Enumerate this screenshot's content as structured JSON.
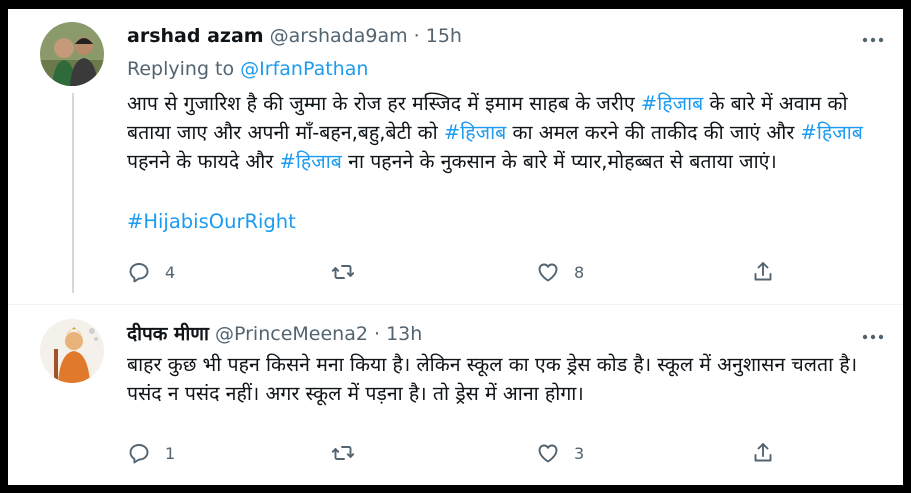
{
  "tweets": [
    {
      "name": "arshad azam",
      "handle": "@arshada9am",
      "sep": "·",
      "time": "15h",
      "replying_prefix": "Replying to",
      "replying_to": "@IrfanPathan",
      "body": [
        {
          "t": "आप से गुजारिश है की जुम्मा के रोज हर मस्जिद में इमाम साहब के जरीए ",
          "tag": false
        },
        {
          "t": "#हिजाब",
          "tag": true
        },
        {
          "t": " के बारे में अवाम को बताया जाए और अपनी माँ-बहन,बहु,बेटी को ",
          "tag": false
        },
        {
          "t": "#हिजाब",
          "tag": true
        },
        {
          "t": " का अमल करने की ताकीद की जाएं और ",
          "tag": false
        },
        {
          "t": "#हिजाब",
          "tag": true
        },
        {
          "t": " पहनने के फायदे और ",
          "tag": false
        },
        {
          "t": "#हिजाब",
          "tag": true
        },
        {
          "t": " ना पहनने के नुकसान के बारे में प्यार,मोहब्बत से बताया जाएं।",
          "tag": false
        }
      ],
      "hashtag_line": "#HijabisOurRight",
      "replies": "4",
      "retweets": "",
      "likes": "8"
    },
    {
      "name": "दीपक मीणा",
      "handle": "@PrinceMeena2",
      "sep": "·",
      "time": "13h",
      "body": [
        {
          "t": "बाहर कुछ भी पहन किसने मना किया है। लेकिन स्कूल का एक ड्रेस कोड है। स्कूल में अनुशासन चलता है। पसंद न पसंद नहीं। अगर स्कूल में पड़ना है। तो ड्रेस में आना होगा।",
          "tag": false
        }
      ],
      "replies": "1",
      "retweets": "",
      "likes": "3"
    }
  ],
  "colors": {
    "link": "#1d9bf0",
    "text": "#0f1419",
    "muted": "#536471",
    "frame": "#000000"
  },
  "icons": [
    "reply-icon",
    "retweet-icon",
    "like-icon",
    "share-icon",
    "more-icon"
  ]
}
